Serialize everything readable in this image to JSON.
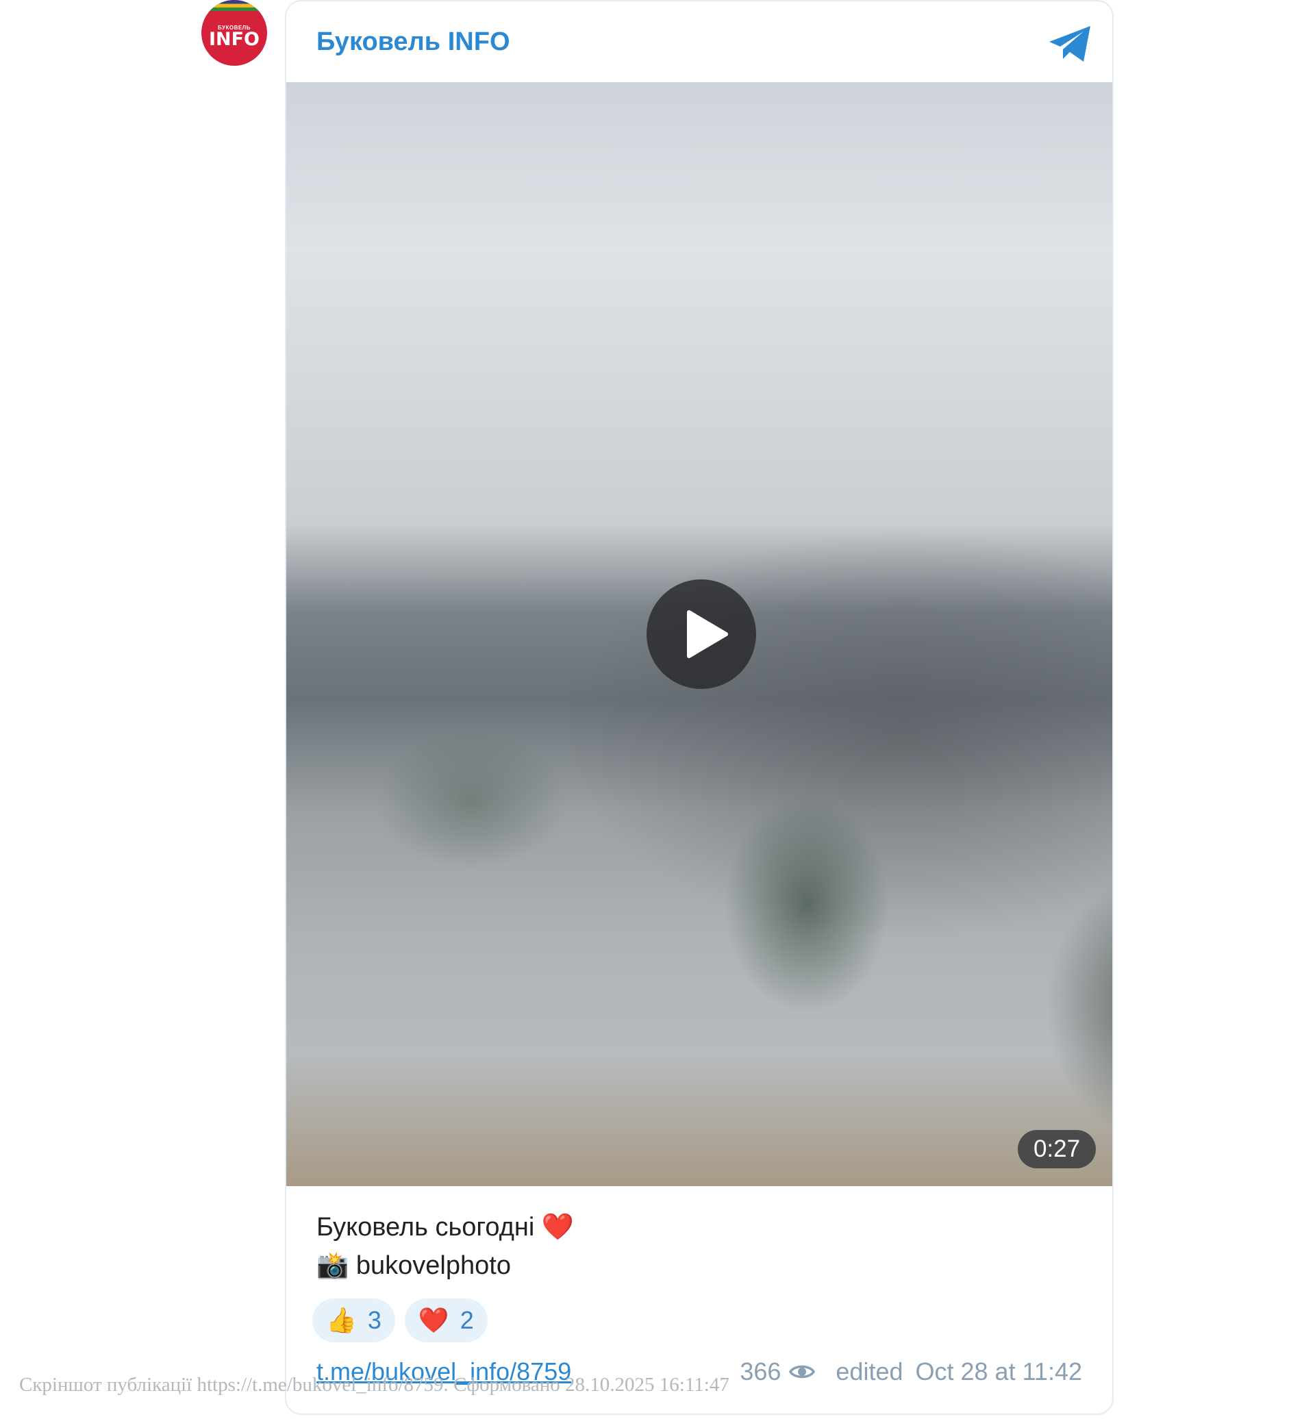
{
  "channel": {
    "name": "Буковель INFO",
    "avatar_small": "БУКОВЕЛЬ",
    "avatar_big": "INFO"
  },
  "video": {
    "duration": "0:27"
  },
  "caption": {
    "line1": "Буковель сьогодні",
    "line1_emoji": "❤️",
    "line2_emoji": "📸",
    "line2": "bukovelphoto"
  },
  "reactions": [
    {
      "emoji": "👍",
      "count": "3"
    },
    {
      "emoji": "❤️",
      "count": "2"
    }
  ],
  "footer": {
    "link": "t.me/bukovel_info/8759",
    "views": "366",
    "edited_label": "edited",
    "date": "Oct 28 at 11:42"
  },
  "watermark": "Скріншот публікації https://t.me/bukovel_info/8759. Сформовано 28.10.2025 16:11:47",
  "colors": {
    "accent": "#2b89d3",
    "avatar": "#d5213a"
  }
}
